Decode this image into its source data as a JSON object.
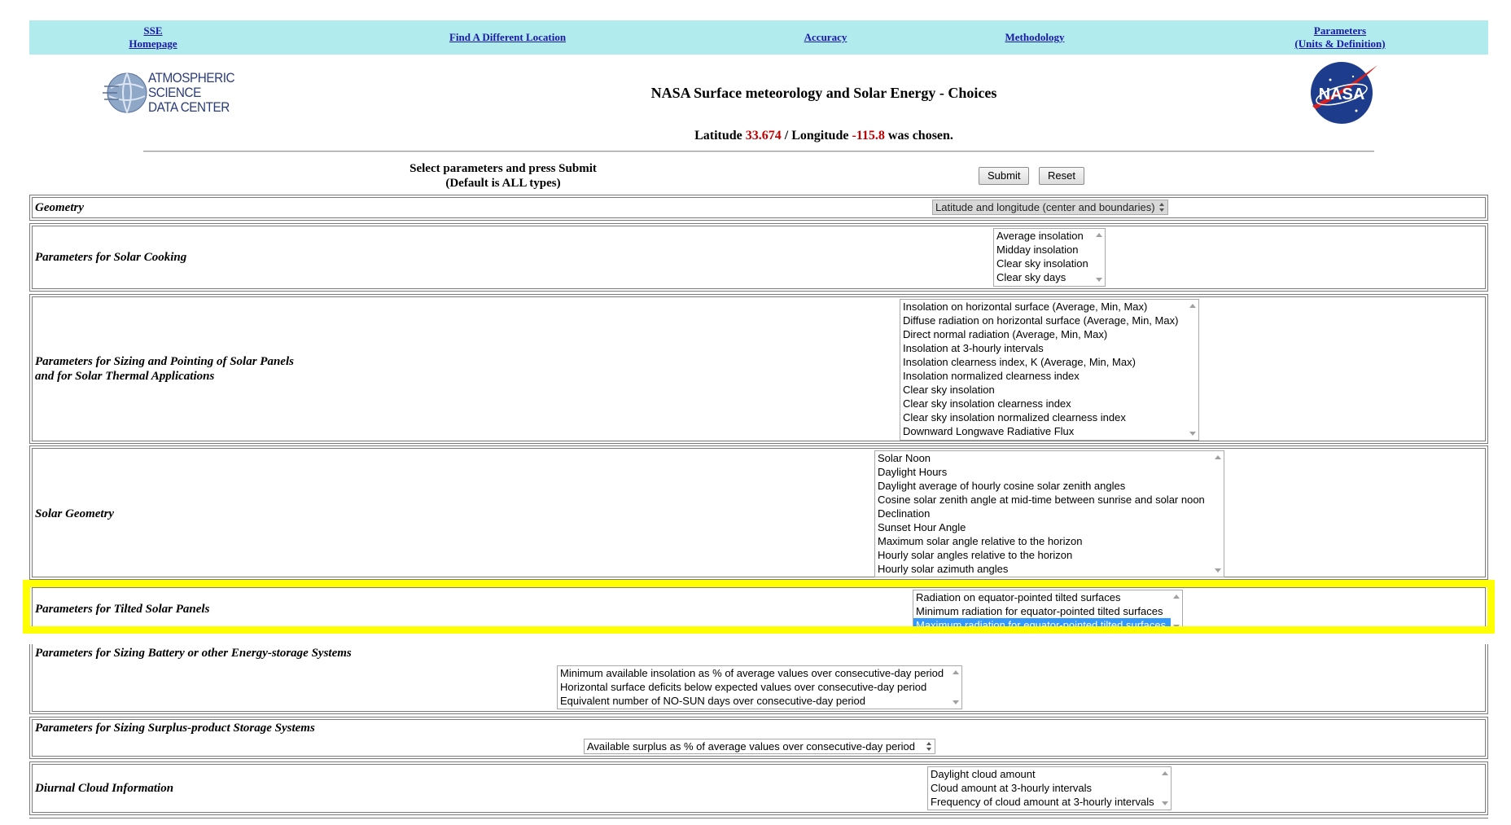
{
  "nav": {
    "sse_line1": "SSE",
    "sse_line2": "Homepage",
    "find_location": "Find A Different Location",
    "accuracy": "Accuracy",
    "methodology": "Methodology",
    "parameters_line1": "Parameters",
    "parameters_line2": "(Units & Definition)"
  },
  "header": {
    "asdc_logo_text": [
      "ATMOSPHERIC",
      "SCIENCE",
      "DATA CENTER"
    ],
    "title": "NASA Surface meteorology and Solar Energy - Choices",
    "nasa_logo_text": "NASA",
    "latitude_label": "Latitude",
    "latitude_value": "33.674",
    "separator": "/",
    "longitude_label": "Longitude",
    "longitude_value": "-115.8",
    "chosen_suffix": "was chosen."
  },
  "form": {
    "instruction_line1": "Select parameters and press Submit",
    "instruction_line2": "(Default is ALL types)",
    "submit_label": "Submit",
    "reset_label": "Reset"
  },
  "sections": {
    "geometry": {
      "label": "Geometry",
      "selected": "Latitude and longitude (center and boundaries)"
    },
    "solar_cooking": {
      "label": "Parameters for Solar Cooking",
      "options": [
        "Average insolation",
        "Midday insolation",
        "Clear sky insolation",
        "Clear sky days"
      ]
    },
    "solar_panels": {
      "label_line1": "Parameters for Sizing and Pointing of Solar Panels",
      "label_line2": "and for Solar Thermal Applications",
      "options": [
        "Insolation on horizontal surface (Average, Min, Max)",
        "Diffuse radiation on horizontal surface (Average, Min, Max)",
        "Direct normal radiation (Average, Min, Max)",
        "Insolation at 3-hourly intervals",
        "Insolation clearness index, K (Average, Min, Max)",
        "Insolation normalized clearness index",
        "Clear sky insolation",
        "Clear sky insolation clearness index",
        "Clear sky insolation normalized clearness index",
        "Downward Longwave Radiative Flux"
      ]
    },
    "solar_geometry": {
      "label": "Solar Geometry",
      "options": [
        "Solar Noon",
        "Daylight Hours",
        "Daylight average of hourly cosine solar zenith angles",
        "Cosine solar zenith angle at mid-time between sunrise and solar noon",
        "Declination",
        "Sunset Hour Angle",
        "Maximum solar angle relative to the horizon",
        "Hourly solar angles relative to the horizon",
        "Hourly solar azimuth angles"
      ]
    },
    "tilted_panels": {
      "label": "Parameters for Tilted Solar Panels",
      "options": [
        "Radiation on equator-pointed tilted surfaces",
        "Minimum radiation for equator-pointed tilted surfaces",
        "Maximum radiation for equator-pointed tilted surfaces"
      ],
      "selected_index": 2
    },
    "battery": {
      "label": "Parameters for Sizing Battery or other Energy-storage Systems",
      "options": [
        "Minimum available insolation as % of average values over consecutive-day period",
        "Horizontal surface deficits below expected values over consecutive-day period",
        "Equivalent number of NO-SUN days over consecutive-day period"
      ]
    },
    "surplus": {
      "label": "Parameters for Sizing Surplus-product Storage Systems",
      "selected": "Available surplus as % of average values over consecutive-day period"
    },
    "diurnal_cloud": {
      "label": "Diurnal Cloud Information",
      "options": [
        "Daylight cloud amount",
        "Cloud amount at 3-hourly intervals",
        "Frequency of cloud amount at 3-hourly intervals"
      ]
    }
  },
  "colors": {
    "nav_bg": "#b2ebee",
    "link": "#1a1aa6",
    "coord_red": "#c00000",
    "highlight": "#ffff00",
    "selection": "#3399ff"
  }
}
